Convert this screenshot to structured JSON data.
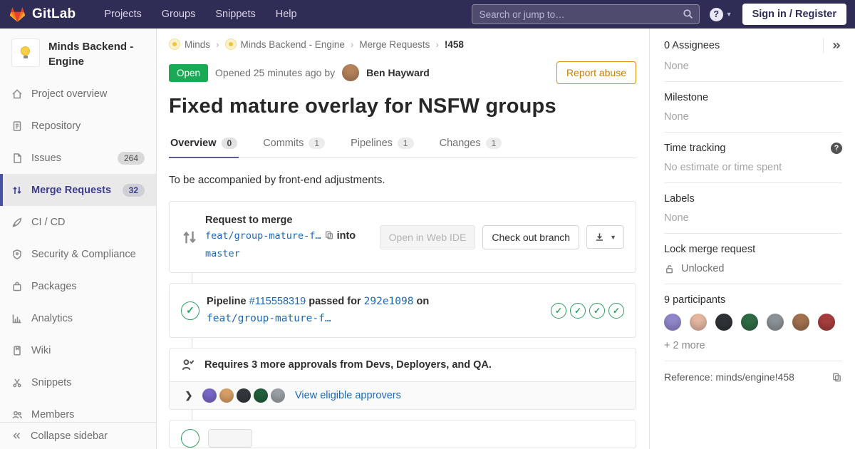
{
  "navbar": {
    "brand": "GitLab",
    "links": [
      "Projects",
      "Groups",
      "Snippets",
      "Help"
    ],
    "search_placeholder": "Search or jump to…",
    "help_glyph": "?",
    "sign_in_label": "Sign in / Register"
  },
  "sidebar": {
    "project_name": "Minds Backend - Engine",
    "items": [
      {
        "label": "Project overview",
        "icon": "home-icon",
        "badge": ""
      },
      {
        "label": "Repository",
        "icon": "document-icon",
        "badge": ""
      },
      {
        "label": "Issues",
        "icon": "issues-icon",
        "badge": "264"
      },
      {
        "label": "Merge Requests",
        "icon": "merge-request-icon",
        "badge": "32"
      },
      {
        "label": "CI / CD",
        "icon": "ci-cd-icon",
        "badge": ""
      },
      {
        "label": "Security & Compliance",
        "icon": "shield-icon",
        "badge": ""
      },
      {
        "label": "Packages",
        "icon": "package-icon",
        "badge": ""
      },
      {
        "label": "Analytics",
        "icon": "chart-icon",
        "badge": ""
      },
      {
        "label": "Wiki",
        "icon": "book-icon",
        "badge": ""
      },
      {
        "label": "Snippets",
        "icon": "scissors-icon",
        "badge": ""
      },
      {
        "label": "Members",
        "icon": "users-icon",
        "badge": ""
      }
    ],
    "collapse_label": "Collapse sidebar"
  },
  "breadcrumb": {
    "items": [
      "Minds",
      "Minds Backend - Engine",
      "Merge Requests"
    ],
    "current": "!458"
  },
  "mr": {
    "state": "Open",
    "opened_text": "Opened 25 minutes ago by",
    "author": "Ben Hayward",
    "report_abuse_label": "Report abuse",
    "title": "Fixed mature overlay for NSFW groups",
    "tabs": [
      {
        "label": "Overview",
        "count": "0"
      },
      {
        "label": "Commits",
        "count": "1"
      },
      {
        "label": "Pipelines",
        "count": "1"
      },
      {
        "label": "Changes",
        "count": "1"
      }
    ],
    "description": "To be accompanied by front-end adjustments.",
    "merge_widget": {
      "request_to_merge": "Request to merge",
      "source_branch": "feat/group-mature-f…",
      "into": "into",
      "target_branch": "master",
      "web_ide_label": "Open in Web IDE",
      "checkout_label": "Check out branch"
    },
    "pipeline": {
      "label": "Pipeline",
      "id": "#115558319",
      "passed_for": "passed for",
      "commit": "292e1098",
      "on": "on",
      "branch": "feat/group-mature-f…",
      "stages": 4,
      "check_glyph": "✓"
    },
    "approvals": {
      "text": "Requires 3 more approvals from Devs, Deployers, and QA.",
      "link": "View eligible approvers",
      "expand_glyph": "❯"
    }
  },
  "right_sidebar": {
    "assignees": {
      "title": "0 Assignees",
      "value": "None"
    },
    "milestone": {
      "title": "Milestone",
      "value": "None"
    },
    "time_tracking": {
      "title": "Time tracking",
      "value": "No estimate or time spent",
      "help_glyph": "?"
    },
    "labels": {
      "title": "Labels",
      "value": "None"
    },
    "lock": {
      "title": "Lock merge request",
      "value": "Unlocked"
    },
    "participants": {
      "title": "9 participants",
      "more": "+ 2 more"
    },
    "reference": "Reference: minds/engine!458"
  },
  "avatars": {
    "author": [
      "#b5835a"
    ],
    "approvers": [
      "#7b68c8",
      "#d9a066",
      "#33383d",
      "#23603c",
      "#9aa0a6"
    ],
    "participants": [
      "#9087c9",
      "#e3b7a0",
      "#2f3338",
      "#2e6b45",
      "#8d9296",
      "#a1704f",
      "#a63d3d"
    ]
  },
  "colors": {
    "navbar_bg": "#2f2c56",
    "open_green": "#1aaa55",
    "link_blue": "#1b69b6",
    "report_orange": "#d98d0b",
    "active_indigo": "#4a51a5",
    "pipeline_green": "#2da160"
  }
}
